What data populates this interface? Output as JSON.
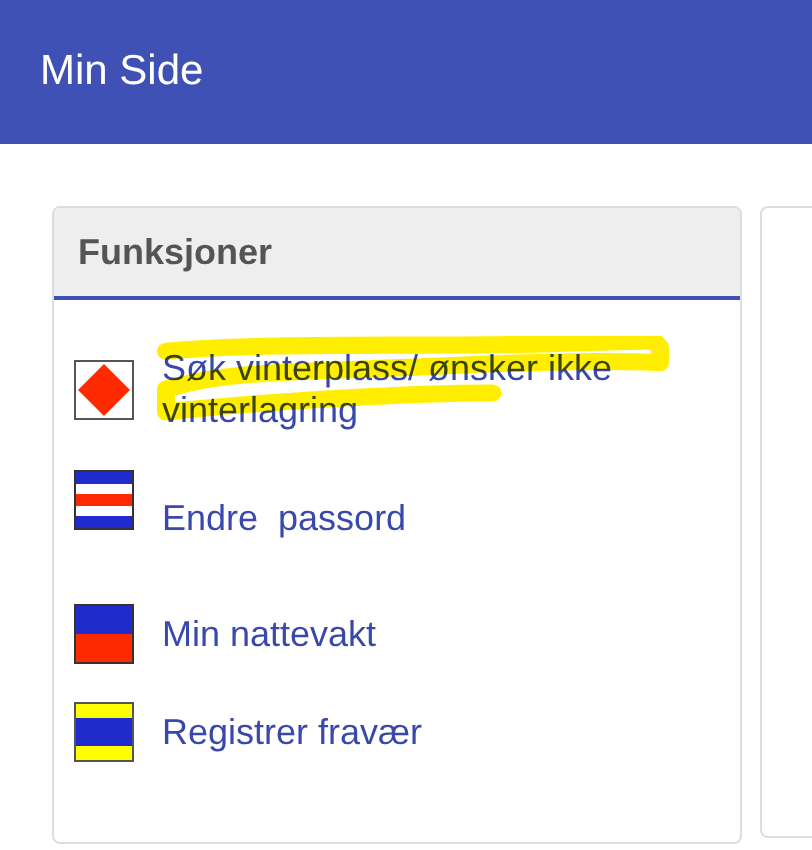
{
  "header": {
    "title": "Min Side"
  },
  "panel": {
    "title": "Funksjoner",
    "items": [
      {
        "label": "Søk vinterplass/ ønsker ikke vinterlagring",
        "kind": "diamond",
        "highlighted": true
      },
      {
        "label": "Endre  passord",
        "kind": "striped",
        "highlighted": false
      },
      {
        "label": "Min nattevakt",
        "kind": "blue-red",
        "highlighted": false
      },
      {
        "label": "Registrer fravær",
        "kind": "yellow-blue",
        "highlighted": false
      }
    ]
  }
}
